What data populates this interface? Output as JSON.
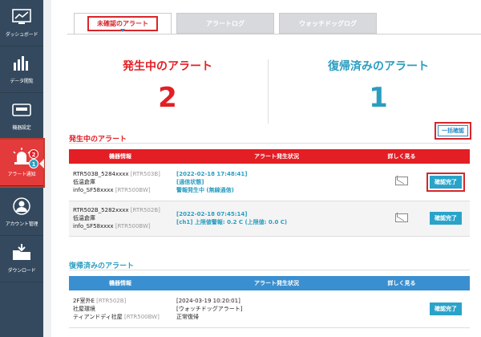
{
  "sidebar": {
    "items": [
      {
        "label": "ダッシュボード",
        "icon": "dashboard-icon"
      },
      {
        "label": "データ閲覧",
        "icon": "bar-chart-icon"
      },
      {
        "label": "機器設定",
        "icon": "device-icon"
      },
      {
        "label": "アラート通知",
        "icon": "alarm-light-icon"
      },
      {
        "label": "アカウント管理",
        "icon": "user-icon"
      },
      {
        "label": "ダウンロード",
        "icon": "download-folder-icon"
      }
    ],
    "alert_badge_red": "2",
    "alert_badge_blue": "1"
  },
  "tabs": [
    "未確認のアラート",
    "アラートログ",
    "ウォッチドッグログ"
  ],
  "summary": {
    "active_title": "発生中のアラート",
    "active_count": "2",
    "recovered_title": "復帰済みのアラート",
    "recovered_count": "1"
  },
  "active_section": {
    "title": "発生中のアラート",
    "bulk_button": "一括確認",
    "headers": [
      "機器情報",
      "アラート発生状況",
      "詳しく見る"
    ],
    "rows": [
      {
        "device_name": "RTR503B_5284xxxx",
        "device_code": "[RTR503B]",
        "location": "低温倉庫",
        "base": "info_SF58xxxx",
        "base_code": "[RTR500BW]",
        "alert_lines": [
          "[2022-02-18 17:48:41]",
          "[通信状態]",
          "警報発生中 (無線通信)"
        ],
        "action": "確認完了"
      },
      {
        "device_name": "RTR502B_5282xxxx",
        "device_code": "[RTR502B]",
        "location": "低温倉庫",
        "base": "info_SF58xxxx",
        "base_code": "[RTR500BW]",
        "alert_lines": [
          "[2022-02-18 07:45:14]",
          "[ch1] 上限値警報: 0.2 C (上限値: 0.0 C)"
        ],
        "action": "確認完了"
      }
    ]
  },
  "recovered_section": {
    "title": "復帰済みのアラート",
    "headers": [
      "機器情報",
      "アラート発生状況",
      "詳しく見る"
    ],
    "rows": [
      {
        "device_name": "2F室外E",
        "device_code": "[RTR502B]",
        "location": "社屋環境",
        "base": "ティアンドディ社屋",
        "base_code": "[RTR500BW]",
        "alert_lines": [
          "[2024-03-19 10:20:01]",
          "[ウォッチドッグアラート]",
          "正常復帰"
        ],
        "action": "確認完了"
      }
    ]
  },
  "colors": {
    "sidebar_bg": "#34495e",
    "active_red": "#e31e24",
    "recovered_blue": "#2a9dc0",
    "active_header": "#e31e24",
    "recovered_header": "#3a8fd0",
    "confirm_button": "#2aa3c9"
  }
}
